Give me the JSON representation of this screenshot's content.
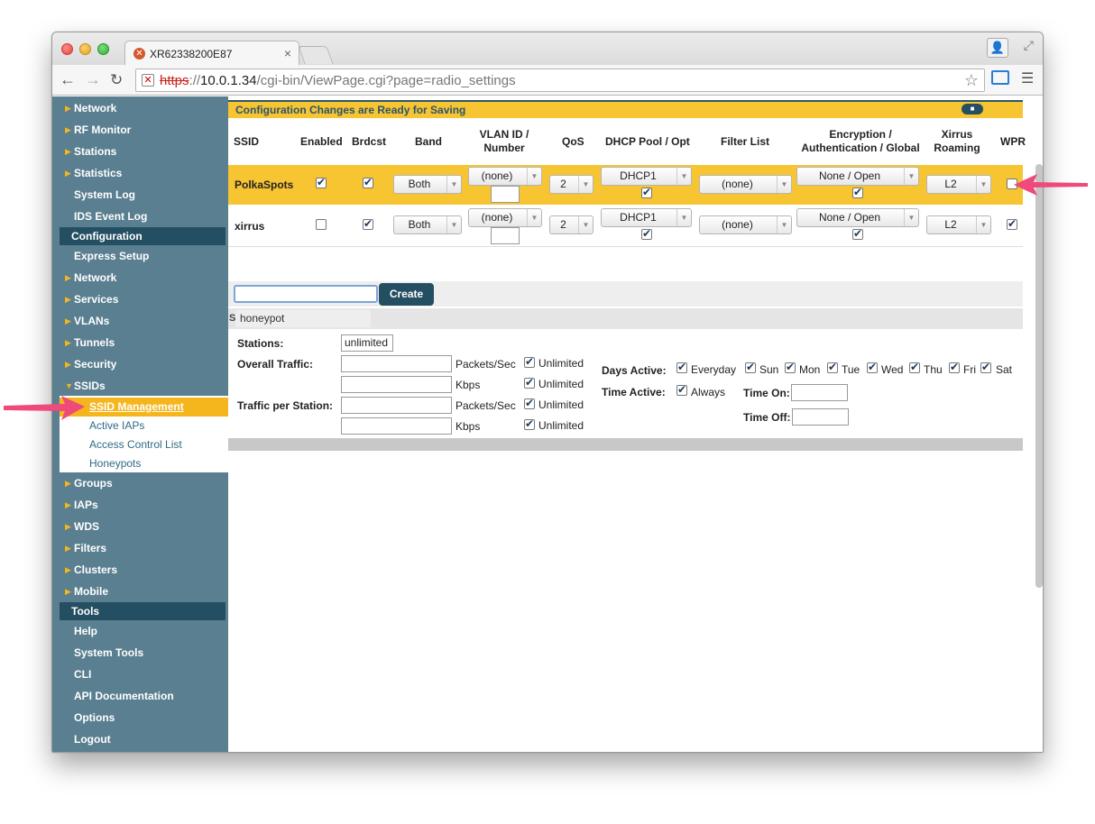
{
  "browser": {
    "tab_title": "XR62338200E87",
    "tab_close": "×",
    "url_scheme": "https",
    "url_sep": "://",
    "url_host": "10.0.1.34",
    "url_path": "/cgi-bin/ViewPage.cgi?page=radio_settings"
  },
  "sidebar": {
    "top_items": [
      {
        "label": "Network"
      },
      {
        "label": "RF Monitor"
      },
      {
        "label": "Stations"
      },
      {
        "label": "Statistics"
      },
      {
        "label": "System Log"
      },
      {
        "label": "IDS Event Log"
      }
    ],
    "section_config": "Configuration",
    "config_items": [
      {
        "label": "Express Setup"
      },
      {
        "label": "Network"
      },
      {
        "label": "Services"
      },
      {
        "label": "VLANs"
      },
      {
        "label": "Tunnels"
      },
      {
        "label": "Security"
      },
      {
        "label": "SSIDs"
      }
    ],
    "ssid_sub": [
      {
        "label": "SSID Management"
      },
      {
        "label": "Active IAPs"
      },
      {
        "label": "Access Control List"
      },
      {
        "label": "Honeypots"
      }
    ],
    "config_items2": [
      {
        "label": "Groups"
      },
      {
        "label": "IAPs"
      },
      {
        "label": "WDS"
      },
      {
        "label": "Filters"
      },
      {
        "label": "Clusters"
      },
      {
        "label": "Mobile"
      }
    ],
    "section_tools": "Tools",
    "tools_items": [
      {
        "label": "Help"
      },
      {
        "label": "System Tools"
      },
      {
        "label": "CLI"
      },
      {
        "label": "API Documentation"
      },
      {
        "label": "Options"
      },
      {
        "label": "Logout"
      }
    ]
  },
  "main": {
    "save_banner": "Configuration Changes are Ready for Saving",
    "headers": {
      "ssid": "SSID",
      "enabled": "Enabled",
      "brdcst": "Brdcst",
      "band": "Band",
      "vlan_1": "VLAN ID /",
      "vlan_2": "Number",
      "qos": "QoS",
      "dhcp": "DHCP Pool / Opt",
      "filter": "Filter List",
      "enc_1": "Encryption /",
      "enc_2": "Authentication / Global",
      "roam_1": "Xirrus",
      "roam_2": "Roaming",
      "wpr": "WPR"
    },
    "rows": [
      {
        "ssid": "PolkaSpots",
        "band": "Both",
        "vlan": "(none)",
        "qos": "2",
        "dhcp": "DHCP1",
        "filter": "(none)",
        "enc": "None / Open",
        "roam": "L2"
      },
      {
        "ssid": "xirrus",
        "band": "Both",
        "vlan": "(none)",
        "qos": "2",
        "dhcp": "DHCP1",
        "filter": "(none)",
        "enc": "None / Open",
        "roam": "L2"
      }
    ],
    "create_label": "Create",
    "suggest_prefix": "S",
    "suggestion": "honeypot",
    "limits": {
      "stations_label": "Stations:",
      "stations_value": "unlimited",
      "overall_label": "Overall Traffic:",
      "per_station_label": "Traffic per Station:",
      "packets_unit": "Packets/Sec",
      "kbps_unit": "Kbps",
      "unlimited": "Unlimited"
    },
    "schedule": {
      "days_label": "Days Active:",
      "everyday": "Everyday",
      "days": [
        "Sun",
        "Mon",
        "Tue",
        "Wed",
        "Thu",
        "Fri",
        "Sat"
      ],
      "time_label": "Time Active:",
      "always": "Always",
      "time_on": "Time On:",
      "time_off": "Time Off:"
    }
  }
}
